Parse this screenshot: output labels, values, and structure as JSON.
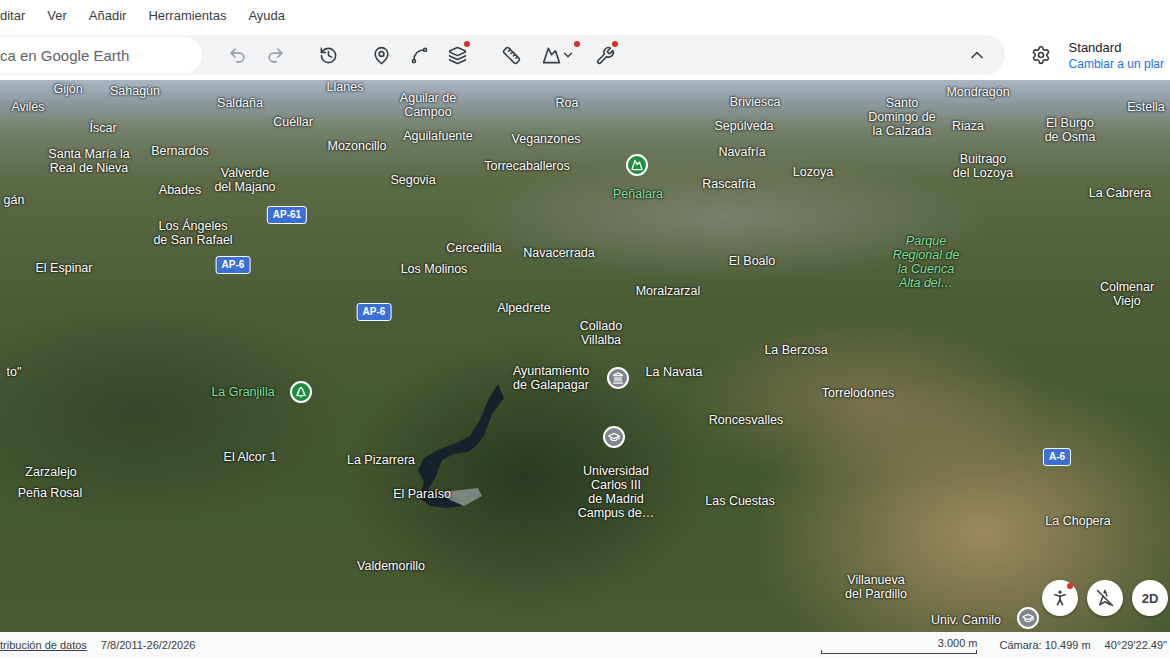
{
  "menu": [
    "ditar",
    "Ver",
    "Añadir",
    "Herramientas",
    "Ayuda"
  ],
  "toolbar": {
    "search_placeholder": "ca en Google Earth",
    "tools": [
      {
        "disabled": true,
        "notify": false
      },
      {
        "disabled": true,
        "notify": false
      },
      {
        "disabled": false,
        "notify": false
      },
      {
        "disabled": false,
        "notify": false
      },
      {
        "disabled": false,
        "notify": false
      },
      {
        "disabled": false,
        "notify": true
      },
      {
        "disabled": false,
        "notify": false
      },
      {
        "disabled": false,
        "notify": true
      },
      {
        "disabled": false,
        "notify": true
      }
    ]
  },
  "map_style": {
    "label": "Standard",
    "link": "Cambiar a un plar"
  },
  "places": [
    {
      "label": "Gijón",
      "kind": "town",
      "pin": false
    },
    {
      "label": "Sahagún",
      "kind": "town",
      "pin": false
    },
    {
      "label": "Avilés",
      "kind": "town",
      "pin": false
    },
    {
      "label": "Llanes",
      "kind": "town",
      "pin": false
    },
    {
      "label": "Aguilar de\nCampoo",
      "kind": "town",
      "pin": false
    },
    {
      "label": "Saldaña",
      "kind": "town",
      "pin": false
    },
    {
      "label": "Roa",
      "kind": "town",
      "pin": false
    },
    {
      "label": "Briviesca",
      "kind": "town",
      "pin": false
    },
    {
      "label": "Santo\nDomingo de\nla Calzada",
      "kind": "town",
      "pin": false
    },
    {
      "label": "Mondragón",
      "kind": "town",
      "pin": false
    },
    {
      "label": "Estella",
      "kind": "town",
      "pin": false
    },
    {
      "label": "Íscar",
      "kind": "town",
      "pin": false
    },
    {
      "label": "Cuéllar",
      "kind": "town",
      "pin": false
    },
    {
      "label": "Aguilafuente",
      "kind": "town",
      "pin": false
    },
    {
      "label": "Veganzones",
      "kind": "town",
      "pin": false
    },
    {
      "label": "Sepúlveda",
      "kind": "town",
      "pin": false
    },
    {
      "label": "Riaza",
      "kind": "town",
      "pin": false
    },
    {
      "label": "El Burgo\nde Osma",
      "kind": "town",
      "pin": false
    },
    {
      "label": "Santa María la\nReal de Nieva",
      "kind": "town",
      "pin": false
    },
    {
      "label": "Bernardos",
      "kind": "town",
      "pin": false
    },
    {
      "label": "Mozoncillo",
      "kind": "town",
      "pin": false
    },
    {
      "label": "Torrecaballeros",
      "kind": "town",
      "pin": false
    },
    {
      "label": "Navafría",
      "kind": "town",
      "pin": false
    },
    {
      "label": "Buitrago\ndel Lozoya",
      "kind": "town",
      "pin": false
    },
    {
      "label": "Valverde\ndel Majano",
      "kind": "town",
      "pin": false
    },
    {
      "label": "Lozoya",
      "kind": "town",
      "pin": false
    },
    {
      "label": "Rascafría",
      "kind": "town",
      "pin": false
    },
    {
      "label": "Peñalara",
      "kind": "park",
      "pin": true
    },
    {
      "label": "Segovia",
      "kind": "town",
      "pin": false
    },
    {
      "label": "Abades",
      "kind": "town",
      "pin": false
    },
    {
      "label": "gán",
      "kind": "town",
      "pin": false
    },
    {
      "label": "La Cabrera",
      "kind": "town",
      "pin": false
    },
    {
      "label": "Los Ángeles\nde San Rafael",
      "kind": "town",
      "pin": false
    },
    {
      "label": "Cercedilla",
      "kind": "town",
      "pin": false
    },
    {
      "label": "Navacerrada",
      "kind": "town",
      "pin": false
    },
    {
      "label": "El Boalo",
      "kind": "town",
      "pin": false
    },
    {
      "label": "Parque\nRegional de\nla Cuenca\nAlta del…",
      "kind": "area",
      "pin": false
    },
    {
      "label": "El Espinar",
      "kind": "town",
      "pin": false
    },
    {
      "label": "Los Molinos",
      "kind": "town",
      "pin": false
    },
    {
      "label": "Moralzarzal",
      "kind": "town",
      "pin": false
    },
    {
      "label": "Colmenar\nViejo",
      "kind": "town",
      "pin": false
    },
    {
      "label": "Alpedrete",
      "kind": "town",
      "pin": false
    },
    {
      "label": "Collado\nVillalba",
      "kind": "town",
      "pin": false
    },
    {
      "label": "La Berzosa",
      "kind": "town",
      "pin": false
    },
    {
      "label": "Ayuntamiento\nde Galapagar",
      "kind": "poi",
      "pin": true
    },
    {
      "label": "La Navata",
      "kind": "town",
      "pin": false
    },
    {
      "label": "Torrelodones",
      "kind": "town",
      "pin": false
    },
    {
      "label": "La Granjilla",
      "kind": "park",
      "pin": true
    },
    {
      "label": "Roncesvalles",
      "kind": "town",
      "pin": false
    },
    {
      "label": "El Alcor 1",
      "kind": "town",
      "pin": false
    },
    {
      "label": "La Pizarrera",
      "kind": "town",
      "pin": false
    },
    {
      "label": "Universidad\nCarlos III\nde Madrid\nCampus de…",
      "kind": "poi",
      "pin": true
    },
    {
      "label": "Zarzalejo",
      "kind": "town",
      "pin": false
    },
    {
      "label": "Peña Rosal",
      "kind": "town",
      "pin": false
    },
    {
      "label": "El Paraíso",
      "kind": "town",
      "pin": false
    },
    {
      "label": "Las Cuestas",
      "kind": "town",
      "pin": false
    },
    {
      "label": "La Chopera",
      "kind": "town",
      "pin": false
    },
    {
      "label": "Valdemorillo",
      "kind": "town",
      "pin": false
    },
    {
      "label": "Villanueva\ndel Pardillo",
      "kind": "town",
      "pin": false
    },
    {
      "label": "Univ. Camilo",
      "kind": "poi",
      "pin": true
    },
    {
      "label": "to\"",
      "kind": "town",
      "pin": false
    }
  ],
  "shields": [
    "AP-61",
    "AP-6",
    "AP-6",
    "A-6"
  ],
  "map_controls": {
    "pegman_notify": true,
    "view_toggle": "2D"
  },
  "status_bar": {
    "attribution": "tribución de datos",
    "dates": "7/8/2011-26/2/2026",
    "scale": "3.000 m",
    "camera": "Cámara: 10.499 m",
    "coords": "40°29'22.49\""
  }
}
